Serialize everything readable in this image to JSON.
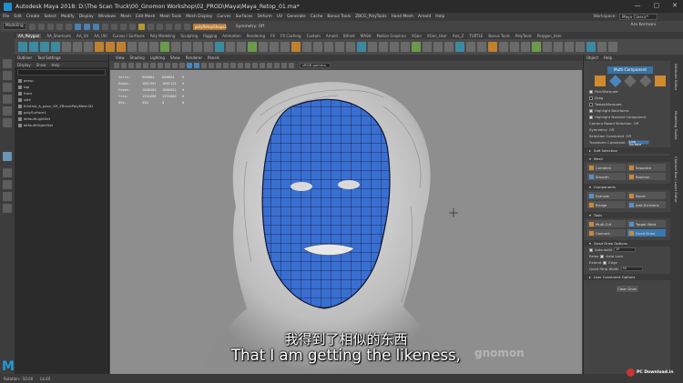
{
  "titlebar": {
    "title": "Autodesk Maya 2018: D:\\The Scan Truck\\00_Gnomon Workshop\\02_PROD\\Maya\\Maya_Retop_01.ma*",
    "minimize": "—",
    "maximize": "▢",
    "close": "✕"
  },
  "menu": [
    "File",
    "Edit",
    "Create",
    "Select",
    "Modify",
    "Display",
    "Windows",
    "Mesh",
    "Edit Mesh",
    "Mesh Tools",
    "Mesh Display",
    "Curves",
    "Surfaces",
    "Deform",
    "UV",
    "Generate",
    "Cache",
    "Bonus Tools",
    "ZBCG_PolyTools",
    "Hand Mesh",
    "Arnold",
    "Help"
  ],
  "workspace": {
    "label": "Workspace:",
    "value": "Maya Classic*"
  },
  "statusline": {
    "mode": "Modeling",
    "live_surface": "polyRetopShape1",
    "symmetry": "Symmetry: Off",
    "user": "Ara Kermani"
  },
  "shelf_tabs": [
    "AA_Polygon",
    "AA_Shortcuts",
    "AA_UV",
    "AA_Util",
    "Curves / Surfaces",
    "Poly Modeling",
    "Sculpting",
    "Rigging",
    "Animation",
    "Rendering",
    "FX",
    "FX Caching",
    "Custom",
    "Arnold",
    "Bifrost",
    "MASH",
    "Motion Graphics",
    "XGen",
    "XGen_User",
    "Ana_Z",
    "TURTLE",
    "Bonus Tools",
    "PolyTools",
    "Polygon_User"
  ],
  "outliner": {
    "tabs": [
      "Outliner",
      "Tool Settings"
    ],
    "menu": [
      "Display",
      "Show",
      "Help"
    ],
    "search": "",
    "items": [
      "persp",
      "top",
      "front",
      "side",
      "Kristina_A_pose_1M_ZBrushPolyMesh3D",
      "polySurface1",
      "defaultLightSet",
      "defaultObjectSet"
    ]
  },
  "viewport": {
    "menu": [
      "View",
      "Shading",
      "Lighting",
      "Show",
      "Renderer",
      "Panels"
    ],
    "gamma": "sRGB gamma",
    "hud": [
      {
        "k": "Verts:",
        "a": "666664",
        "b": "666664",
        "c": "0"
      },
      {
        "k": "Edges:",
        "a": "1861901",
        "b": "1861124",
        "c": "0"
      },
      {
        "k": "Faces:",
        "a": "1866584",
        "b": "1866952",
        "c": "0"
      },
      {
        "k": "Tris:",
        "a": "1331686",
        "b": "1331600",
        "c": "0"
      },
      {
        "k": "UVs:",
        "a": "530",
        "b": "0",
        "c": "0"
      }
    ],
    "subtitle_cn": "我得到了相似的东西",
    "subtitle_en": "That I am getting the likeness,",
    "watermark": "gnomon"
  },
  "panel": {
    "tabs": [
      "Object",
      "Help"
    ],
    "header": "Multi-Component",
    "rows": [
      {
        "label": "Pick/Marquee",
        "check": true
      },
      {
        "label": "Drag",
        "check": false
      },
      {
        "label": "Tweak/Marquee",
        "check": false
      },
      {
        "label": "Highlight Backfaces",
        "check": true
      },
      {
        "label": "Highlight Nearest Component",
        "check": true
      }
    ],
    "camera_based": "Camera Based Selection",
    "camera_based_val": "Off",
    "symmetry": "Symmetry",
    "symmetry_val": "Off",
    "sel_constraint": "Selection Constraint",
    "sel_constraint_val": "Off",
    "transform_constraint": "Transform Constraint",
    "transform_constraint_val": "Live Surface",
    "soft_selection": "Soft Selection",
    "mesh_section": "Mesh",
    "mesh_buttons": [
      "Combine",
      "Separate",
      "Smooth",
      "Boolean"
    ],
    "components_section": "Components",
    "components_buttons": [
      "Extrude",
      "Bevel",
      "Bridge",
      "Add Divisions"
    ],
    "tools_section": "Tools",
    "tools_buttons": [
      "Multi-Cut",
      "Target Weld",
      "Connect",
      "Quad Draw"
    ],
    "quad_draw_options": "Quad Draw Options",
    "auto_weld": "Auto weld",
    "auto_weld_val": "10",
    "relax": "Relax",
    "relax_val": "Auto Lock",
    "extend": "Extend",
    "extend_val": "Edge",
    "quad_strip": "Quad Strip Width",
    "quad_strip_val": "50",
    "user_constraint": "User Constraint Options",
    "clear_btn": "Clear Gnds"
  },
  "vtabs": [
    "Attribute Editor",
    "Modelling Toolkit",
    "Channel Box / Layer Editor"
  ],
  "cmdline": [
    "Rotation: -50.00",
    "Lk:40"
  ],
  "brand": {
    "maya": "M",
    "pcdl": "PC Download.in"
  },
  "colors": {
    "mesh_blue": "#3a6fd2",
    "accent": "#3973a3"
  }
}
